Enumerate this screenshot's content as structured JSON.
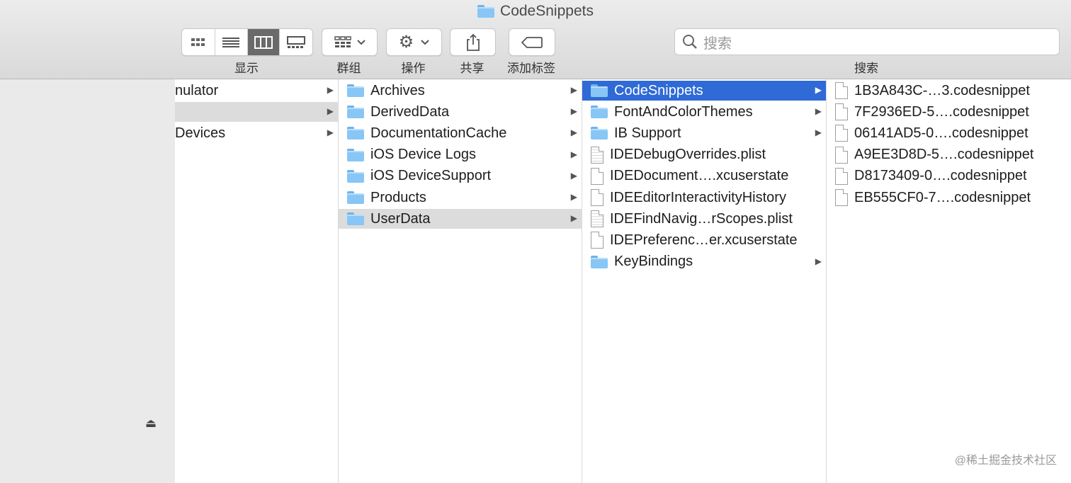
{
  "window": {
    "title": "CodeSnippets"
  },
  "toolbar": {
    "view_label": "显示",
    "group_label": "群组",
    "action_label": "操作",
    "share_label": "共享",
    "tags_label": "添加标签",
    "search_label": "搜索",
    "search_placeholder": "搜索"
  },
  "column1": {
    "items": [
      {
        "label": "nulator",
        "arrow": true
      },
      {
        "label": "",
        "arrow": true,
        "selected": true
      },
      {
        "label": "Devices",
        "arrow": true
      }
    ]
  },
  "column2": {
    "items": [
      {
        "label": "Archives",
        "icon": "folder-icon",
        "arrow": true
      },
      {
        "label": "DerivedData",
        "icon": "folder-icon",
        "arrow": true
      },
      {
        "label": "DocumentationCache",
        "icon": "folder-icon",
        "arrow": true
      },
      {
        "label": "iOS Device Logs",
        "icon": "folder-icon",
        "arrow": true
      },
      {
        "label": "iOS DeviceSupport",
        "icon": "folder-icon",
        "arrow": true
      },
      {
        "label": "Products",
        "icon": "folder-icon",
        "arrow": true
      },
      {
        "label": "UserData",
        "icon": "folder-icon",
        "arrow": true,
        "selected": true
      }
    ]
  },
  "column3": {
    "items": [
      {
        "label": "CodeSnippets",
        "icon": "folder-icon",
        "arrow": true,
        "active": true
      },
      {
        "label": "FontAndColorThemes",
        "icon": "folder-icon",
        "arrow": true
      },
      {
        "label": "IB Support",
        "icon": "folder-icon",
        "arrow": true
      },
      {
        "label": "IDEDebugOverrides.plist",
        "icon": "plist-file-icon",
        "arrow": false
      },
      {
        "label": "IDEDocument….xcuserstate",
        "icon": "document-icon",
        "arrow": false
      },
      {
        "label": "IDEEditorInteractivityHistory",
        "icon": "document-icon",
        "arrow": false
      },
      {
        "label": "IDEFindNavig…rScopes.plist",
        "icon": "plist-file-icon",
        "arrow": false
      },
      {
        "label": "IDEPreferenc…er.xcuserstate",
        "icon": "document-icon",
        "arrow": false
      },
      {
        "label": "KeyBindings",
        "icon": "folder-icon",
        "arrow": true
      }
    ]
  },
  "column4": {
    "items": [
      {
        "label": "1B3A843C-…3.codesnippet",
        "icon": "document-icon"
      },
      {
        "label": "7F2936ED-5….codesnippet",
        "icon": "document-icon"
      },
      {
        "label": "06141AD5-0….codesnippet",
        "icon": "document-icon"
      },
      {
        "label": "A9EE3D8D-5….codesnippet",
        "icon": "document-icon"
      },
      {
        "label": "D8173409-0….codesnippet",
        "icon": "document-icon"
      },
      {
        "label": "EB555CF0-7….codesnippet",
        "icon": "document-icon"
      }
    ]
  },
  "watermark": "@稀土掘金技术社区",
  "colors": {
    "selection_active": "#2f6ad6",
    "selection_inactive": "#dcdcdc",
    "folder": "#88c6f5"
  }
}
